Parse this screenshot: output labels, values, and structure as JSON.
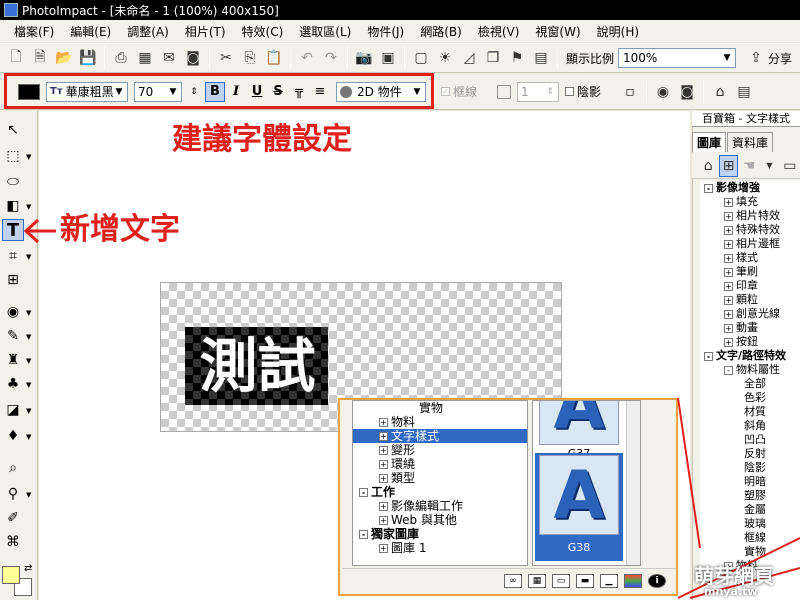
{
  "window": {
    "title": "PhotoImpact - [未命名 - 1 (100%) 400x150]"
  },
  "menu": [
    "檔案(F)",
    "編輯(E)",
    "調整(A)",
    "相片(T)",
    "特效(C)",
    "選取區(L)",
    "物件(J)",
    "網路(B)",
    "檢視(V)",
    "視窗(W)",
    "說明(H)"
  ],
  "toolbar": {
    "zoom_label": "顯示比例",
    "zoom_value": "100%",
    "share_label": "分享"
  },
  "text_toolbar": {
    "color": "#000000",
    "font_name": "華康粗黑",
    "font_size": "70",
    "bold_on": true,
    "mode": "2D 物件",
    "border_label": "框線",
    "border_width": "1",
    "shadow_label": "陰影"
  },
  "annotations": {
    "font_settings": "建議字體設定",
    "add_text": "新增文字"
  },
  "canvas": {
    "text": "測試"
  },
  "right_panel": {
    "title": "百寶箱 - 文字樣式",
    "tabs": [
      "圖庫",
      "資料庫"
    ],
    "tree": [
      {
        "level": 0,
        "sign": "-",
        "label": "影像增強",
        "bold": true
      },
      {
        "level": 1,
        "sign": "+",
        "label": "填充"
      },
      {
        "level": 1,
        "sign": "+",
        "label": "相片特效"
      },
      {
        "level": 1,
        "sign": "+",
        "label": "特殊特效"
      },
      {
        "level": 1,
        "sign": "+",
        "label": "相片邊框"
      },
      {
        "level": 1,
        "sign": "+",
        "label": "樣式"
      },
      {
        "level": 1,
        "sign": "+",
        "label": "筆刷"
      },
      {
        "level": 1,
        "sign": "+",
        "label": "印章"
      },
      {
        "level": 1,
        "sign": "+",
        "label": "顆粒"
      },
      {
        "level": 1,
        "sign": "+",
        "label": "創意光線"
      },
      {
        "level": 1,
        "sign": "+",
        "label": "動畫"
      },
      {
        "level": 1,
        "sign": "+",
        "label": "按鈕"
      },
      {
        "level": 0,
        "sign": "-",
        "label": "文字/路徑特效",
        "bold": true
      },
      {
        "level": 1,
        "sign": "-",
        "label": "物料屬性"
      },
      {
        "level": 2,
        "sign": "",
        "label": "全部"
      },
      {
        "level": 2,
        "sign": "",
        "label": "色彩"
      },
      {
        "level": 2,
        "sign": "",
        "label": "材質"
      },
      {
        "level": 2,
        "sign": "",
        "label": "斜角"
      },
      {
        "level": 2,
        "sign": "",
        "label": "凹凸"
      },
      {
        "level": 2,
        "sign": "",
        "label": "反射"
      },
      {
        "level": 2,
        "sign": "",
        "label": "陰影"
      },
      {
        "level": 2,
        "sign": "",
        "label": "明暗"
      },
      {
        "level": 2,
        "sign": "",
        "label": "塑膠"
      },
      {
        "level": 2,
        "sign": "",
        "label": "金屬"
      },
      {
        "level": 2,
        "sign": "",
        "label": "玻璃"
      },
      {
        "level": 2,
        "sign": "",
        "label": "框線"
      },
      {
        "level": 2,
        "sign": "",
        "label": "實物"
      },
      {
        "level": 1,
        "sign": "+",
        "label": "物料"
      }
    ]
  },
  "zoom_inset": {
    "tree": [
      {
        "level": 3,
        "sign": "",
        "label": "實物",
        "selected": false
      },
      {
        "level": 1,
        "sign": "+",
        "label": "物料",
        "selected": false
      },
      {
        "level": 1,
        "sign": "+",
        "label": "文字樣式",
        "selected": true
      },
      {
        "level": 1,
        "sign": "+",
        "label": "變形",
        "selected": false
      },
      {
        "level": 1,
        "sign": "+",
        "label": "環繞",
        "selected": false
      },
      {
        "level": 1,
        "sign": "+",
        "label": "類型",
        "selected": false
      },
      {
        "level": 0,
        "sign": "-",
        "label": "工作",
        "selected": false,
        "bold": true
      },
      {
        "level": 1,
        "sign": "+",
        "label": "影像編輯工作",
        "selected": false
      },
      {
        "level": 1,
        "sign": "+",
        "label": "Web 與其他",
        "selected": false
      },
      {
        "level": 0,
        "sign": "-",
        "label": "獨家圖庫",
        "selected": false,
        "bold": true
      },
      {
        "level": 1,
        "sign": "+",
        "label": "圖庫 1",
        "selected": false
      }
    ],
    "thumbs": [
      {
        "label": "G37",
        "letter": "A",
        "selected": false
      },
      {
        "label": "G38",
        "letter": "A",
        "selected": true
      }
    ]
  },
  "watermark": "萌芽網頁",
  "watermark_url": "mnya.tw"
}
